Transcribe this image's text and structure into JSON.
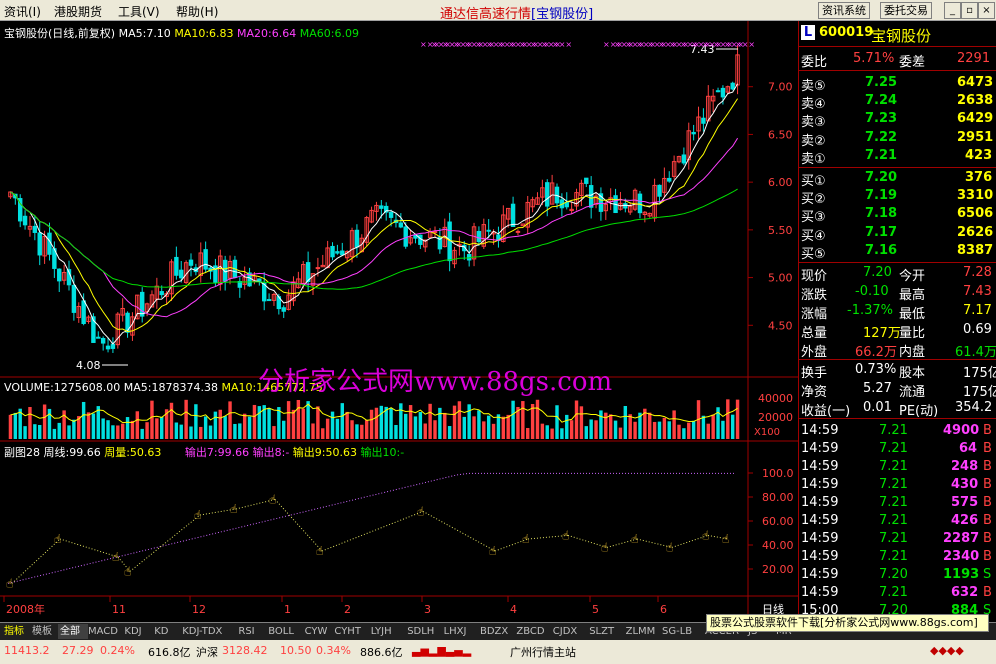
{
  "menu": {
    "items": [
      "资讯(I)",
      "港股期货",
      "工具(V)",
      "帮助(H)"
    ],
    "center_title": "通达信高速行情",
    "center_stock": "[宝钢股份]",
    "buttons": [
      "资讯系统",
      "委托交易"
    ]
  },
  "kline": {
    "header": "宝钢股份(日线,前复权)",
    "ma5": "MA5:7.10",
    "ma10": "MA10:6.83",
    "ma20": "MA20:6.64",
    "ma60": "MA60:6.09",
    "high_label": "7.43",
    "low_label": "4.08",
    "price_ticks": [
      "7.00",
      "6.50",
      "6.00",
      "5.50",
      "5.00",
      "4.50"
    ],
    "watermark": "分析家公式网www.88gs.com"
  },
  "volume": {
    "header_vol": "VOLUME:1275608.00",
    "header_ma5": "MA5:1878374.38",
    "header_ma10": "MA10:1465772.75",
    "ticks": [
      "40000",
      "20000"
    ],
    "scale": "X100"
  },
  "indicator": {
    "name": "副图28",
    "zhouxian": "周线:99.66",
    "zhouliang": "周量:50.63",
    "out7": "输出7:99.66",
    "out8": "输出8:-",
    "out9": "输出9:50.63",
    "out10": "输出10:-",
    "ticks": [
      "100.0",
      "80.00",
      "60.00",
      "40.00",
      "20.00"
    ]
  },
  "xaxis": {
    "labels": [
      "2008年",
      "11",
      "12",
      "1",
      "2",
      "3",
      "4",
      "5",
      "6"
    ],
    "period": "日线"
  },
  "chart_data": {
    "type": "candlestick",
    "title": "宝钢股份(日线,前复权)",
    "ylim": [
      4.0,
      7.5
    ],
    "x": [
      "2008-10",
      "2008-11",
      "2008-12",
      "2009-01",
      "2009-02",
      "2009-03",
      "2009-04",
      "2009-05",
      "2009-06"
    ],
    "close_approx": [
      5.9,
      4.3,
      5.2,
      4.8,
      5.6,
      5.3,
      5.9,
      5.8,
      7.2
    ],
    "ma_lines": [
      {
        "name": "MA5",
        "color": "#ffffff"
      },
      {
        "name": "MA10",
        "color": "#ffff00"
      },
      {
        "name": "MA20",
        "color": "#ff40ff"
      },
      {
        "name": "MA60",
        "color": "#00e000"
      }
    ]
  },
  "stock": {
    "badge": "L",
    "code": "600019",
    "name": "宝钢股份",
    "weibi_label": "委比",
    "weibi": "5.71%",
    "weicha_label": "委差",
    "weicha": "2291",
    "sells": [
      {
        "label": "卖⑤",
        "price": "7.25",
        "vol": "6473"
      },
      {
        "label": "卖④",
        "price": "7.24",
        "vol": "2638"
      },
      {
        "label": "卖③",
        "price": "7.23",
        "vol": "6429"
      },
      {
        "label": "卖②",
        "price": "7.22",
        "vol": "2951"
      },
      {
        "label": "卖①",
        "price": "7.21",
        "vol": "423"
      }
    ],
    "buys": [
      {
        "label": "买①",
        "price": "7.20",
        "vol": "376"
      },
      {
        "label": "买②",
        "price": "7.19",
        "vol": "3310"
      },
      {
        "label": "买③",
        "price": "7.18",
        "vol": "6506"
      },
      {
        "label": "买④",
        "price": "7.17",
        "vol": "2626"
      },
      {
        "label": "买⑤",
        "price": "7.16",
        "vol": "8387"
      }
    ],
    "quote": [
      {
        "l1": "现价",
        "v1": "7.20",
        "l2": "今开",
        "v2": "7.28"
      },
      {
        "l1": "涨跌",
        "v1": "-0.10",
        "l2": "最高",
        "v2": "7.43"
      },
      {
        "l1": "涨幅",
        "v1": "-1.37%",
        "l2": "最低",
        "v2": "7.17"
      },
      {
        "l1": "总量",
        "v1": "127万",
        "l2": "量比",
        "v2": "0.69"
      },
      {
        "l1": "外盘",
        "v1": "66.2万",
        "l2": "内盘",
        "v2": "61.4万"
      }
    ],
    "fund": [
      {
        "l1": "换手",
        "v1": "0.73%",
        "l2": "股本",
        "v2": "175亿"
      },
      {
        "l1": "净资",
        "v1": "5.27",
        "l2": "流通",
        "v2": "175亿"
      },
      {
        "l1": "收益(一)",
        "v1": "0.01",
        "l2": "PE(动)",
        "v2": "354.2"
      }
    ],
    "ticks": [
      {
        "t": "14:59",
        "p": "7.21",
        "v": "4900",
        "s": "B"
      },
      {
        "t": "14:59",
        "p": "7.21",
        "v": "64",
        "s": "B"
      },
      {
        "t": "14:59",
        "p": "7.21",
        "v": "248",
        "s": "B"
      },
      {
        "t": "14:59",
        "p": "7.21",
        "v": "430",
        "s": "B"
      },
      {
        "t": "14:59",
        "p": "7.21",
        "v": "575",
        "s": "B"
      },
      {
        "t": "14:59",
        "p": "7.21",
        "v": "426",
        "s": "B"
      },
      {
        "t": "14:59",
        "p": "7.21",
        "v": "2287",
        "s": "B"
      },
      {
        "t": "14:59",
        "p": "7.21",
        "v": "2340",
        "s": "B"
      },
      {
        "t": "14:59",
        "p": "7.20",
        "v": "1193",
        "s": "S"
      },
      {
        "t": "14:59",
        "p": "7.21",
        "v": "632",
        "s": "B"
      },
      {
        "t": "15:00",
        "p": "7.20",
        "v": "884",
        "s": "S"
      }
    ]
  },
  "tabs": [
    "指标",
    "模板",
    "全部",
    "MACD",
    "KDJ",
    "KD",
    "KDJ-TDX",
    "RSI",
    "BOLL",
    "CYW",
    "CYHT",
    "LYJH",
    "SDLH",
    "LHXJ",
    "BDZX",
    "ZBCD",
    "CJDX",
    "SLZT",
    "ZLMM",
    "SG-LB",
    "ACCER",
    "JS",
    "MR"
  ],
  "ad_banner": "股票公式股票软件下载[分析家公式网www.88gs.com]",
  "status": {
    "idx1": "11413.2",
    "idx1_chg": "27.29",
    "idx1_pct": "0.24%",
    "idx1_amt": "616.8亿",
    "idx2_name": "沪深",
    "idx2": "3128.42",
    "idx2_chg": "10.50",
    "idx2_pct": "0.34%",
    "idx2_amt": "886.6亿",
    "server": "广州行情主站"
  }
}
